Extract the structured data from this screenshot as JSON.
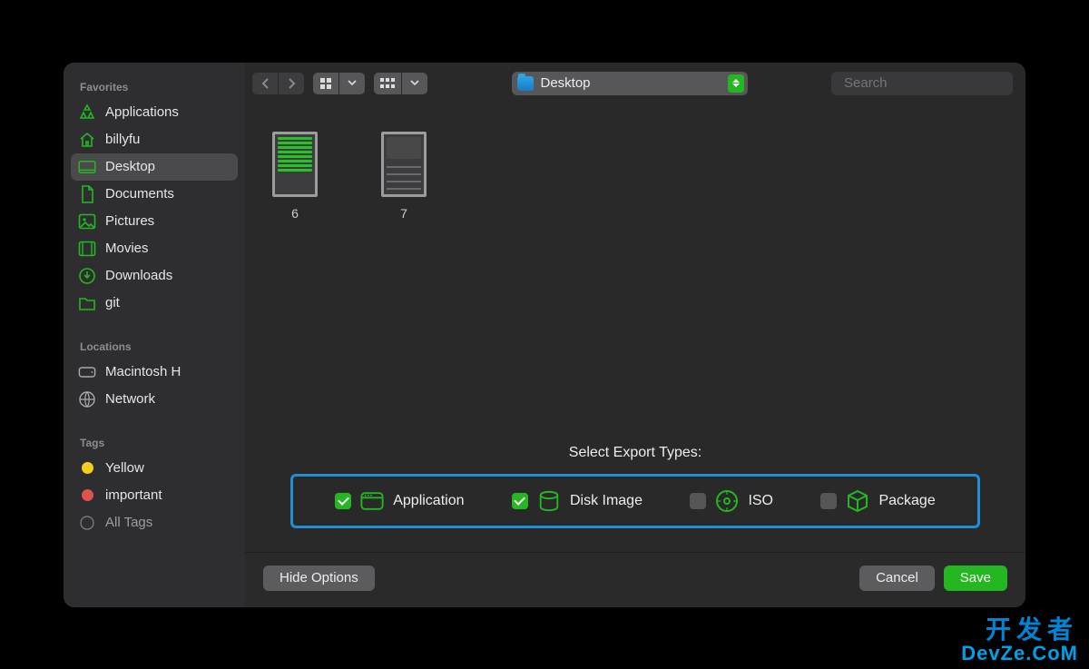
{
  "sidebar": {
    "favorites": {
      "header": "Favorites",
      "items": [
        {
          "icon": "app",
          "label": "Applications",
          "selected": false
        },
        {
          "icon": "home",
          "label": "billyfu",
          "selected": false
        },
        {
          "icon": "desktop",
          "label": "Desktop",
          "selected": true
        },
        {
          "icon": "doc",
          "label": "Documents",
          "selected": false
        },
        {
          "icon": "pictures",
          "label": "Pictures",
          "selected": false
        },
        {
          "icon": "movies",
          "label": "Movies",
          "selected": false
        },
        {
          "icon": "download",
          "label": "Downloads",
          "selected": false
        },
        {
          "icon": "folder",
          "label": "git",
          "selected": false
        }
      ]
    },
    "locations": {
      "header": "Locations",
      "items": [
        {
          "icon": "hdd",
          "label": "Macintosh H"
        },
        {
          "icon": "network",
          "label": "Network"
        }
      ]
    },
    "tags": {
      "header": "Tags",
      "items": [
        {
          "color": "#f2cf1f",
          "label": "Yellow"
        },
        {
          "color": "#e0524d",
          "label": "important"
        },
        {
          "color": "none",
          "label": "All Tags"
        }
      ]
    }
  },
  "toolbar": {
    "location": "Desktop",
    "search_placeholder": "Search"
  },
  "files": [
    {
      "name": "6"
    },
    {
      "name": "7"
    }
  ],
  "export": {
    "title": "Select Export Types:",
    "options": [
      {
        "checked": true,
        "label": "Application",
        "icon": "app-window"
      },
      {
        "checked": true,
        "label": "Disk Image",
        "icon": "disk-image"
      },
      {
        "checked": false,
        "label": "ISO",
        "icon": "iso"
      },
      {
        "checked": false,
        "label": "Package",
        "icon": "package"
      }
    ]
  },
  "footer": {
    "hide_options": "Hide Options",
    "cancel": "Cancel",
    "save": "Save"
  },
  "watermark": {
    "line1": "开发者",
    "line2": "DevZe.CoM"
  }
}
